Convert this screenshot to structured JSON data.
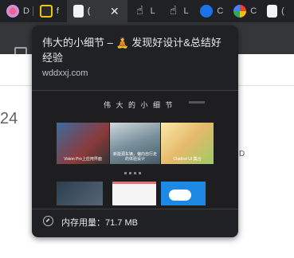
{
  "tabs": [
    {
      "icon": "pink-avatar-icon",
      "label": "D"
    },
    {
      "icon": "dark-avatar-icon",
      "label": "f"
    },
    {
      "icon": "page-icon",
      "label": "(",
      "active": true
    },
    {
      "icon": "hand-cursor-icon",
      "label": "L"
    },
    {
      "icon": "hand-cursor-icon",
      "label": "L"
    },
    {
      "icon": "blue-c-icon",
      "label": "C"
    },
    {
      "icon": "google-icon",
      "label": "C"
    },
    {
      "icon": "page-icon",
      "label": "("
    }
  ],
  "page": {
    "number": "24",
    "side_letter": "D"
  },
  "hovercard": {
    "title": "伟大的小细节 – 🧘 发现好设计&总结好经验",
    "domain": "wddxxj.com",
    "preview": {
      "site_title": "伟 大 的 小 细 节",
      "captions": [
        "Vision Pro上应用界面",
        "新能源车辆，偏向自行走的体验设计",
        "Chatbot UI 集合"
      ]
    },
    "memory_label": "内存用量：71.7 MB"
  }
}
